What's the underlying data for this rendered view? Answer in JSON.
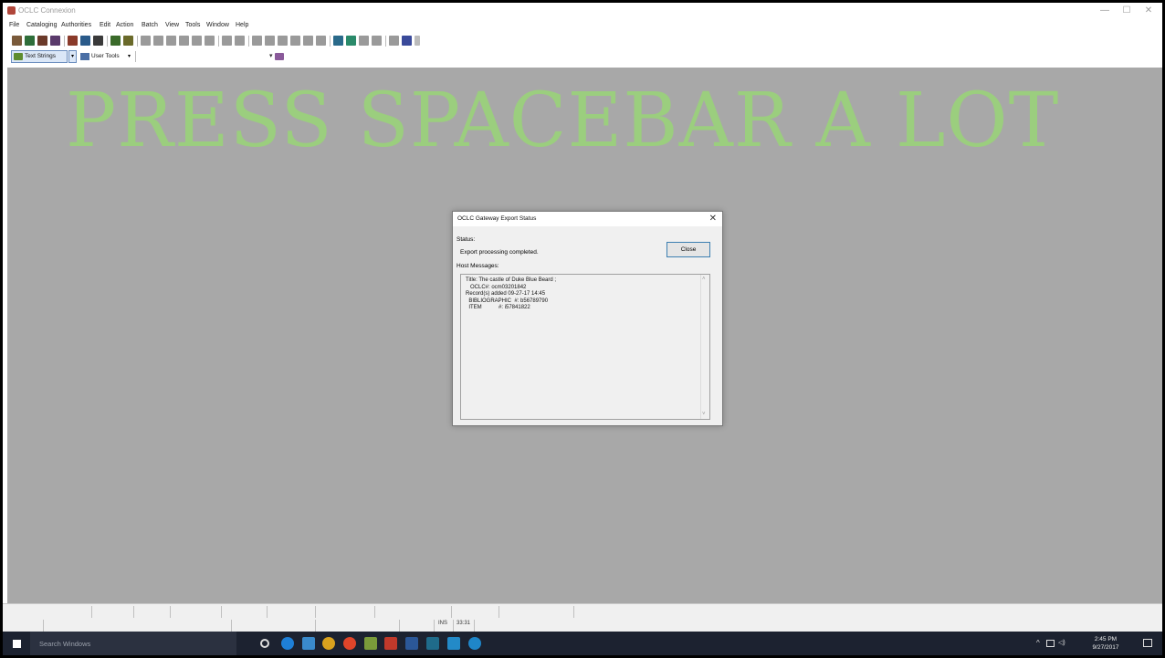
{
  "window": {
    "title": "OCLC Connexion",
    "minimize": "—",
    "maximize": "☐",
    "close": "✕"
  },
  "menubar": {
    "items": [
      "File",
      "Cataloging",
      "Authorities",
      "Edit",
      "Action",
      "Batch",
      "View",
      "Tools",
      "Window",
      "Help"
    ]
  },
  "toolbar2": {
    "text_strings": "Text Strings",
    "text_strings_drop": "▾",
    "user_tools": "User Tools",
    "user_tools_drop": "▾",
    "extra_drop": "▾"
  },
  "workspace": {
    "overlay_text": "PRESS SPACEBAR A LOT",
    "overlay_color": "#9bce7e",
    "background": "#a8a8a8"
  },
  "dialog": {
    "title": "OCLC Gateway Export Status",
    "close_x": "✕",
    "status_label": "Status:",
    "status_value": "Export processing completed.",
    "close_button": "Close",
    "host_label": "Host Messages:",
    "host_messages": [
      "Title: The castle of Duke Blue Beard ;",
      "   OCLC#: ocm03201842",
      "Record(s) added 09-27-17 14:45",
      "  BIBLIOGRAPHIC  #: b56789790",
      "  ITEM           #: i57841822"
    ],
    "scroll_up": "˄",
    "scroll_down": "˅"
  },
  "statusbar": {
    "ins": "INS",
    "position": "33:31"
  },
  "taskbar": {
    "search_placeholder": "Search Windows",
    "tray_up": "^",
    "tray_vol": "◁)",
    "clock_time": "2:45 PM",
    "clock_date": "9/27/2017"
  }
}
